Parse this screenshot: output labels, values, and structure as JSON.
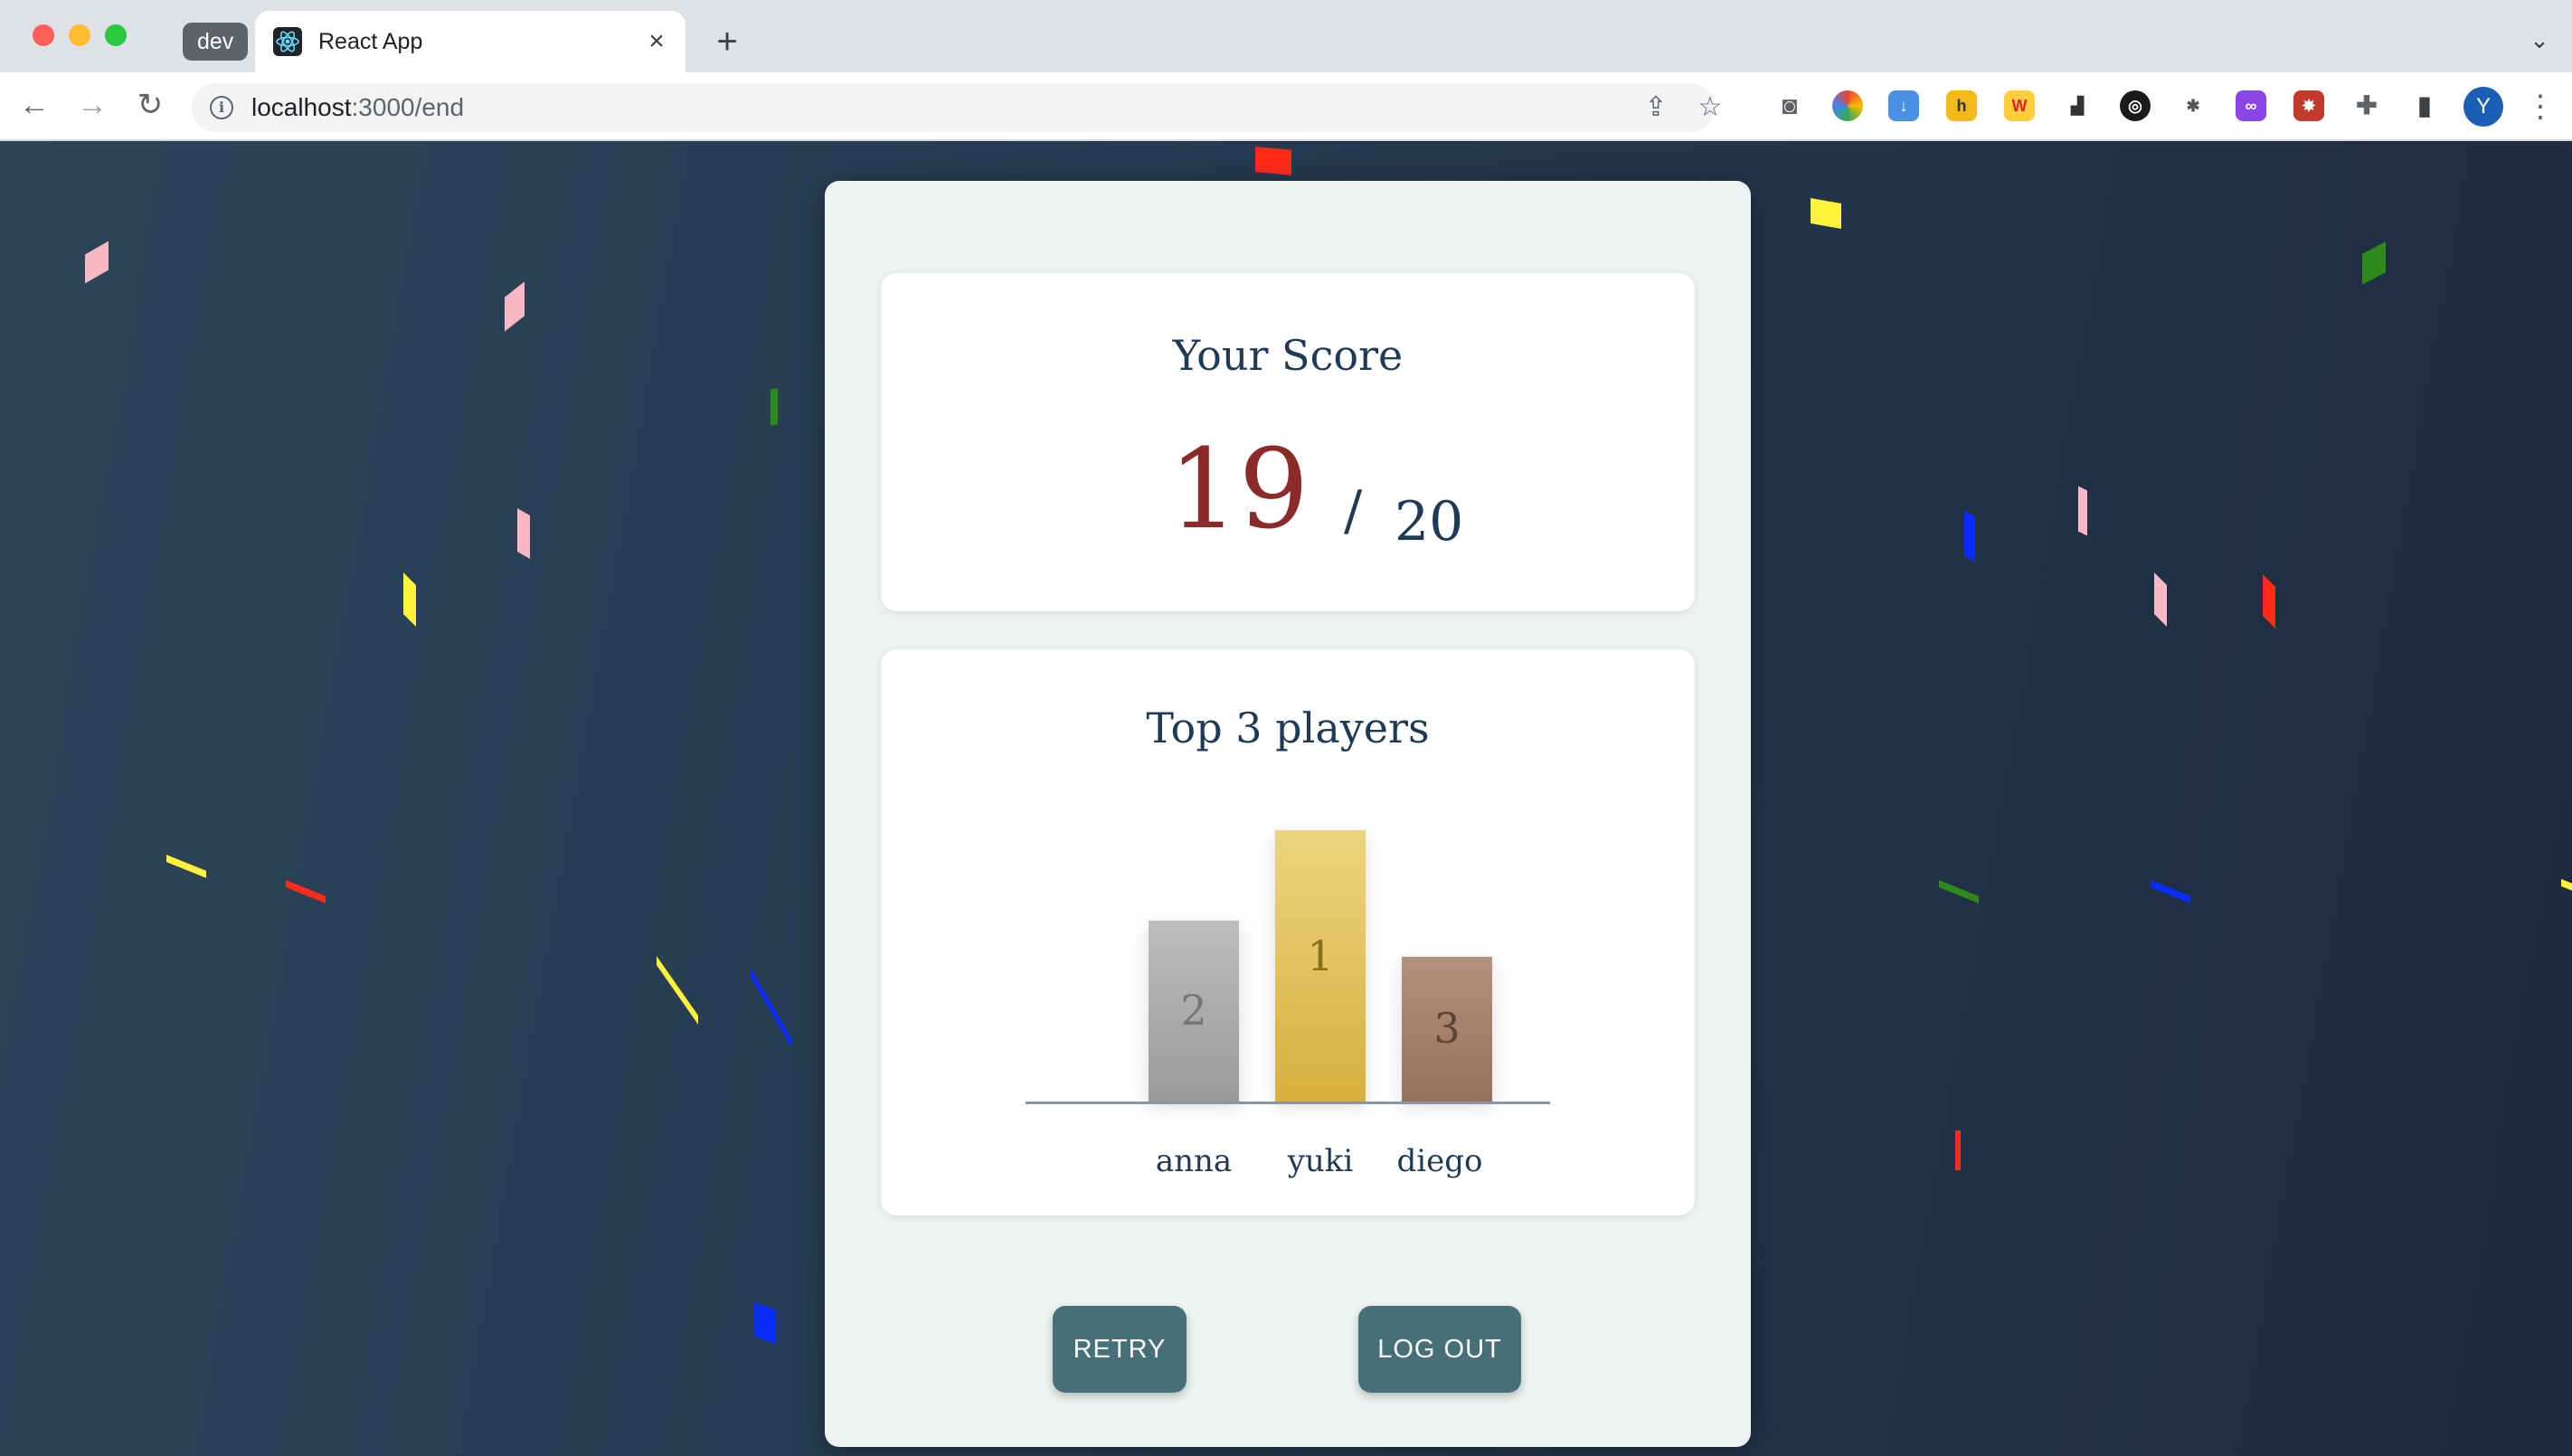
{
  "browser": {
    "profile_chip": "dev",
    "tab_title": "React App",
    "tab_close_glyph": "×",
    "new_tab_glyph": "+",
    "url_host": "localhost",
    "url_path": ":3000/end",
    "avatar_letter": "Y",
    "icons": [
      "back-arrow-icon",
      "forward-arrow-icon",
      "reload-icon",
      "info-icon",
      "share-icon",
      "star-icon",
      "camera-icon",
      "extensions-icon",
      "sidebar-icon",
      "kebab-menu-icon"
    ]
  },
  "score": {
    "title": "Your Score",
    "value": "19",
    "slash": "/",
    "total": "20"
  },
  "podium": {
    "title": "Top 3 players",
    "players": [
      {
        "rank": "2",
        "name": "anna"
      },
      {
        "rank": "1",
        "name": "yuki"
      },
      {
        "rank": "3",
        "name": "diego"
      }
    ]
  },
  "actions": {
    "retry": "RETRY",
    "logout": "LOG OUT"
  },
  "confetti_colors": [
    "#ff2a1a",
    "#f9b8c4",
    "#fff23a",
    "#0a2cff",
    "#2f8a1c"
  ]
}
